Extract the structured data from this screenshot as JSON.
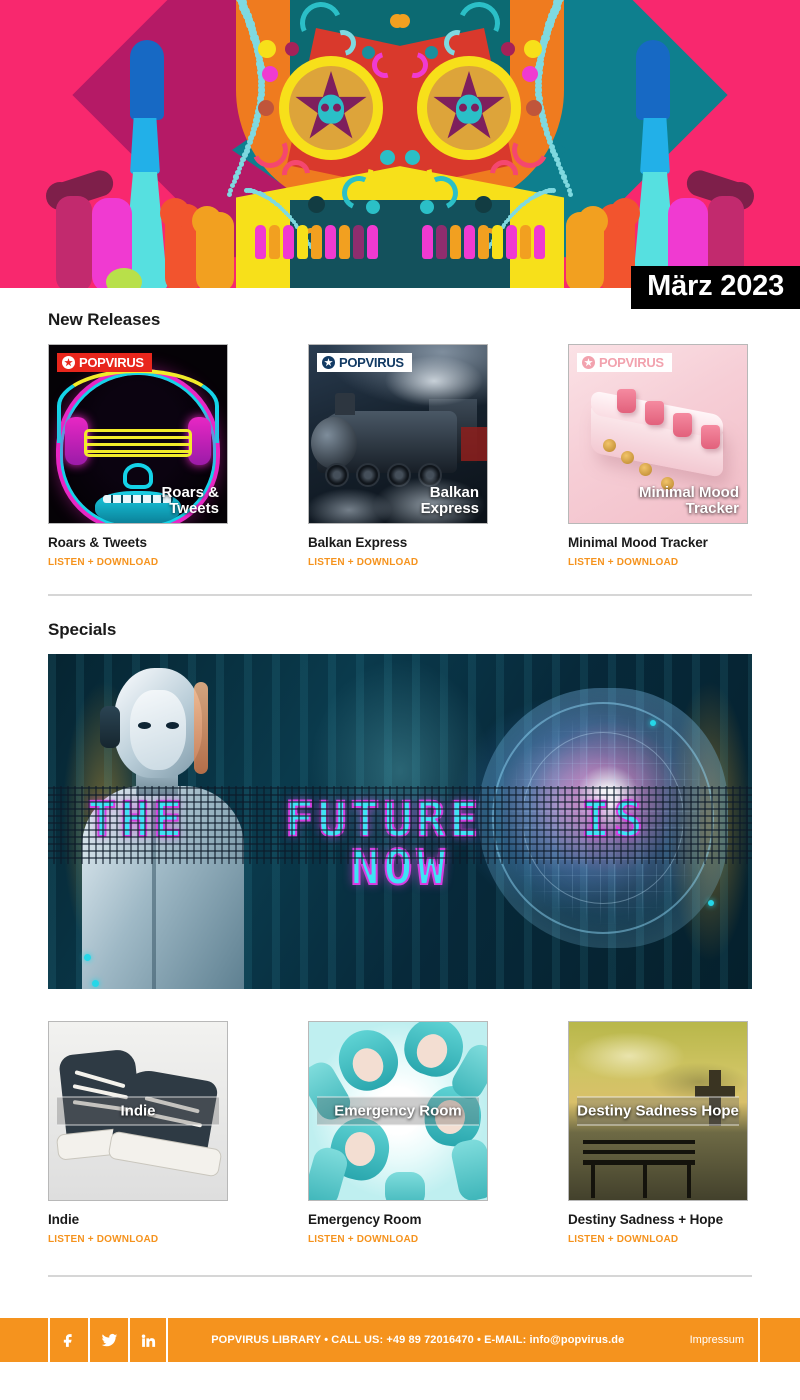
{
  "header": {
    "date_badge": "März 2023",
    "artwork_name": "day-of-the-dead-sugar-skull"
  },
  "sections": [
    {
      "id": "new-releases",
      "title": "New Releases"
    },
    {
      "id": "specials",
      "title": "Specials"
    }
  ],
  "new_releases": {
    "title": "New Releases",
    "items": [
      {
        "title": "Roars & Tweets",
        "cover_caption": "Roars &\nTweets",
        "cover_caption_line1": "Roars &",
        "cover_caption_line2": "Tweets",
        "badge": "POPVIRUS",
        "badge_style": "red",
        "link": "LISTEN + DOWNLOAD"
      },
      {
        "title": "Balkan Express",
        "cover_caption_line1": "Balkan",
        "cover_caption_line2": "Express",
        "badge": "POPVIRUS",
        "badge_style": "white",
        "link": "LISTEN + DOWNLOAD"
      },
      {
        "title": "Minimal Mood Tracker",
        "cover_caption_line1": "Minimal Mood",
        "cover_caption_line2": "Tracker",
        "badge": "POPVIRUS",
        "badge_style": "pink",
        "link": "LISTEN + DOWNLOAD"
      }
    ]
  },
  "specials": {
    "title": "Specials",
    "banner": {
      "text": "THE FUTURE IS NOW",
      "words": [
        "THE",
        "FUTURE",
        "IS",
        "NOW"
      ],
      "image_name": "ai-robot-brain-hero"
    },
    "items": [
      {
        "title": "Indie",
        "cover_caption": "Indie",
        "link": "LISTEN + DOWNLOAD"
      },
      {
        "title": "Emergency Room",
        "cover_caption": "Emergency Room",
        "link": "LISTEN + DOWNLOAD"
      },
      {
        "title": "Destiny Sadness + Hope",
        "cover_caption": "Destiny Sadness Hope",
        "link": "LISTEN + DOWNLOAD"
      }
    ]
  },
  "footer": {
    "social": [
      {
        "name": "facebook",
        "glyph": "f"
      },
      {
        "name": "twitter",
        "glyph": "t"
      },
      {
        "name": "linkedin",
        "glyph": "in"
      }
    ],
    "info": "POPVIRUS LIBRARY • CALL US: +49 89 72016470 • E-MAIL: info@popvirus.de",
    "imprint": "Impressum"
  },
  "colors": {
    "accent_orange": "#f5931e",
    "hero_pink": "#f8286e",
    "badge_black": "#000000",
    "divider_gray": "#d6d6d6",
    "banner_cyan": "#3fe3f5",
    "banner_magenta": "#d63de0"
  }
}
